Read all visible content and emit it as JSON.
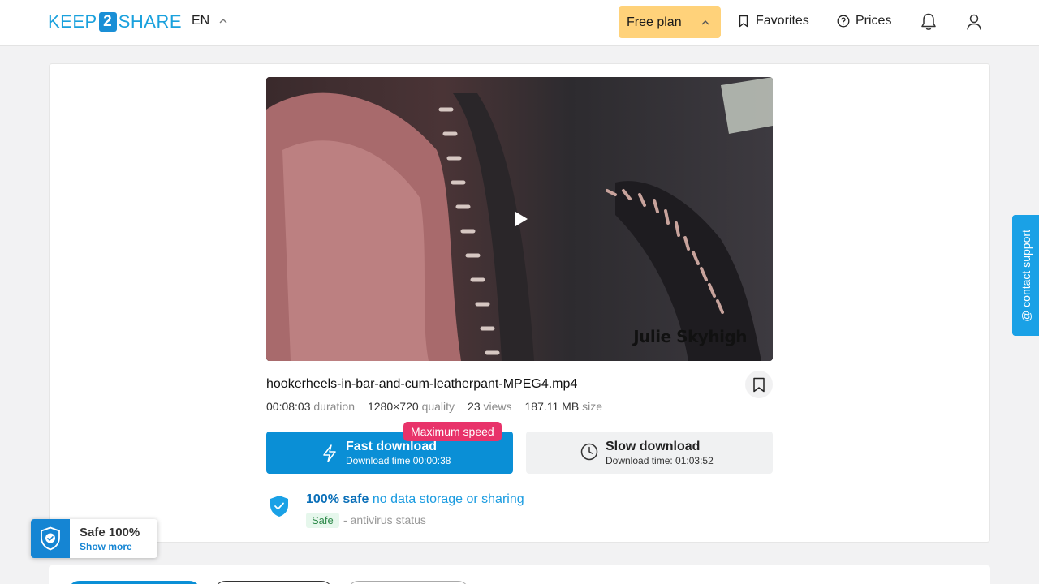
{
  "header": {
    "logo_left": "KEEP",
    "logo_mid": "2",
    "logo_right": "SHARE",
    "language": "EN",
    "plan_label": "Free plan",
    "favorites_label": "Favorites",
    "prices_label": "Prices"
  },
  "video": {
    "watermark": "Julie Skyhigh"
  },
  "file": {
    "name": "hookerheels-in-bar-and-cum-leatherpant-MPEG4.mp4",
    "duration": "00:08:03",
    "duration_label": "duration",
    "quality": "1280×720",
    "quality_label": "quality",
    "views": "23",
    "views_label": "views",
    "size": "187.11 MB",
    "size_label": "size"
  },
  "download": {
    "badge": "Maximum speed",
    "fast_title": "Fast download",
    "fast_subtitle": "Download time 00:00:38",
    "slow_title": "Slow download",
    "slow_subtitle": "Download time: 01:03:52"
  },
  "safety": {
    "strong": "100% safe",
    "light": "no data storage or sharing",
    "tag": "Safe",
    "status": "- antivirus status"
  },
  "widget": {
    "title": "Safe 100%",
    "link": "Show more"
  },
  "support": {
    "label": "@ contact support"
  },
  "colors": {
    "primary": "#0a8fd6",
    "plan": "#ffd27a",
    "badge": "#e8336a",
    "support": "#1aa1e6"
  }
}
